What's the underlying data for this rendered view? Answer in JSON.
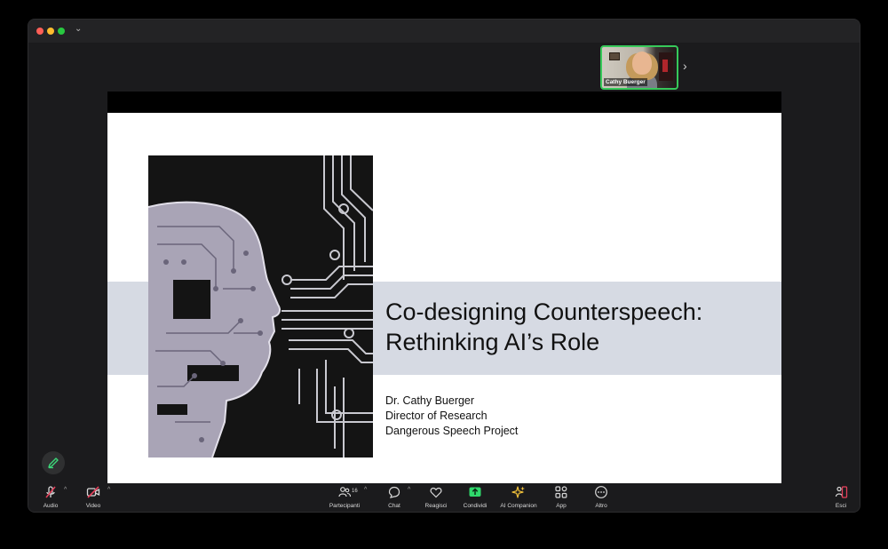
{
  "window": {
    "menu_chevron": "⌄"
  },
  "participant": {
    "name": "Cathy Buerger",
    "next_arrow": "›"
  },
  "slide": {
    "title_line1": "Co-designing Counterspeech:",
    "title_line2": "Rethinking AI’s Role",
    "presenter_name": "Dr. Cathy Buerger",
    "presenter_role": "Director of Research",
    "presenter_org": "Dangerous Speech Project",
    "image_icon": "circuit-head-illustration"
  },
  "toolbar": {
    "audio": "Audio",
    "video": "Video",
    "participants": "Partecipanti",
    "participants_count": "16",
    "chat": "Chat",
    "react": "Reagisci",
    "share": "Condividi",
    "ai_companion": "AI Companion",
    "apps": "App",
    "more": "Altro",
    "leave": "Esci",
    "caret": "^"
  },
  "colors": {
    "accent_green": "#37c95a",
    "share_green": "#2fd96b",
    "muted_red": "#e5405b",
    "ai_yellow": "#f2c23a",
    "band_gray": "#d6dae3"
  }
}
